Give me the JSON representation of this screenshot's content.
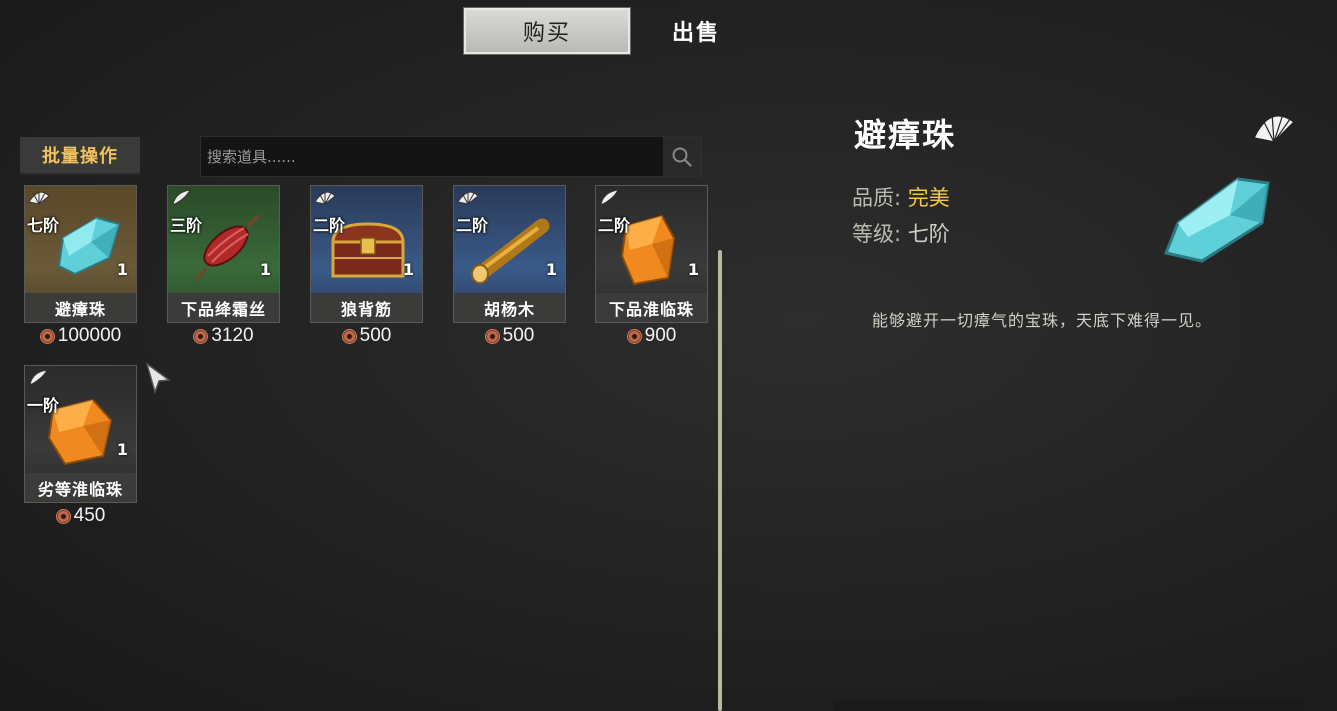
{
  "tabs": {
    "buy_label": "购买",
    "sell_label": "出售"
  },
  "toolbar": {
    "batch_label": "批量操作",
    "search_placeholder": "搜索道具......"
  },
  "items": [
    {
      "tier": "七阶",
      "qty": "1",
      "name": "避瘴珠",
      "price": "100000",
      "icon": "gem-icon",
      "bg": "amber",
      "flag_icon": "fan-icon"
    },
    {
      "tier": "三阶",
      "qty": "1",
      "name": "下品绛霜丝",
      "price": "3120",
      "icon": "silk-spool-icon",
      "bg": "green",
      "flag_icon": "feather-icon"
    },
    {
      "tier": "二阶",
      "qty": "1",
      "name": "狼背筋",
      "price": "500",
      "icon": "treasure-chest-icon",
      "bg": "blue",
      "flag_icon": "fan-icon"
    },
    {
      "tier": "二阶",
      "qty": "1",
      "name": "胡杨木",
      "price": "500",
      "icon": "wood-log-icon",
      "bg": "blue",
      "flag_icon": "fan-icon"
    },
    {
      "tier": "二阶",
      "qty": "1",
      "name": "下品淮临珠",
      "price": "900",
      "icon": "amber-crystal-icon",
      "bg": "dark",
      "flag_icon": "feather-icon"
    },
    {
      "tier": "一阶",
      "qty": "1",
      "name": "劣等淮临珠",
      "price": "450",
      "icon": "amber-crystal-icon",
      "bg": "dark",
      "flag_icon": "feather-icon"
    }
  ],
  "detail": {
    "title": "避瘴珠",
    "quality_label": "品质:",
    "quality_value": "完美",
    "level_label": "等级:",
    "level_value": "七阶",
    "description": "能够避开一切瘴气的宝珠，天底下难得一见。",
    "icon": "gem-icon",
    "flag_icon": "fan-icon"
  },
  "colors": {
    "gold": "#f5c84a",
    "batch_text": "#f0c060",
    "divider": "#bdb6a6"
  }
}
